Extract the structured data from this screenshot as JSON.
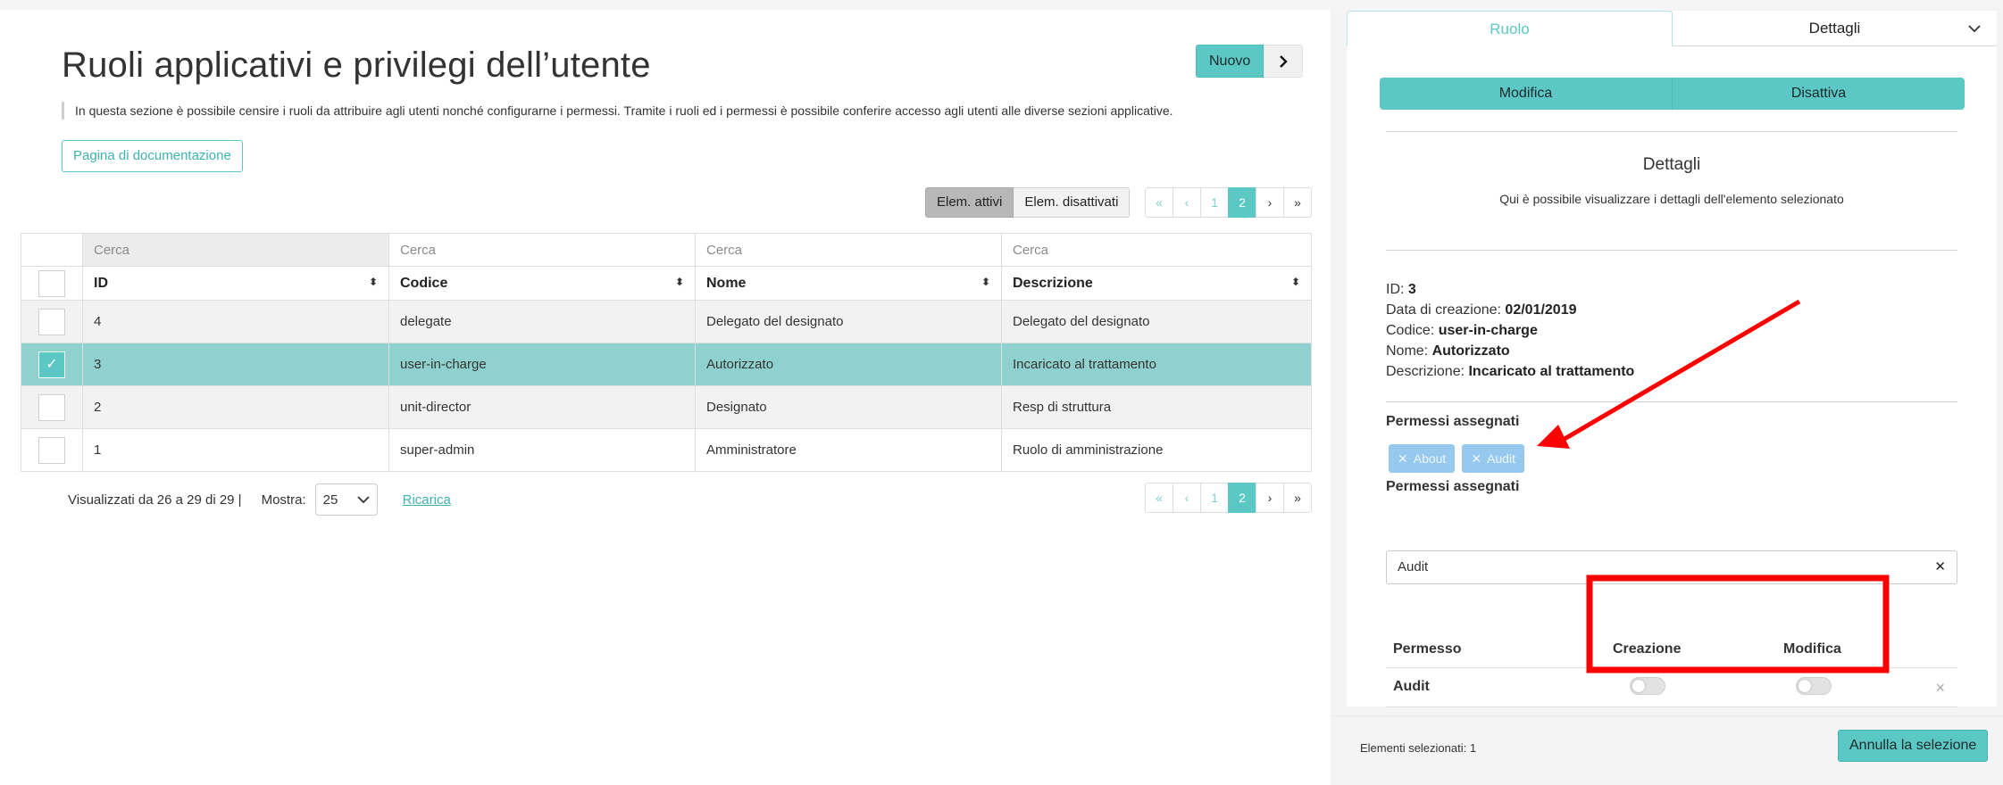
{
  "page": {
    "title": "Ruoli applicativi e privilegi dell’utente",
    "description": "In questa sezione è possibile censire i ruoli da attribuire agli utenti nonché configurarne i permessi. Tramite i ruoli ed i permessi è possibile conferire accesso agli utenti alle diverse sezioni applicative.",
    "doc_button": "Pagina di documentazione",
    "new_button": "Nuovo"
  },
  "filters": {
    "active": "Elem. attivi",
    "inactive": "Elem. disattivati"
  },
  "pager": {
    "first": "«",
    "prev": "‹",
    "page1": "1",
    "page2": "2",
    "next": "›",
    "last": "»"
  },
  "table": {
    "search_placeholder": "Cerca",
    "columns": [
      "ID",
      "Codice",
      "Nome",
      "Descrizione"
    ],
    "sort_icon": "⬍",
    "rows": [
      {
        "id": "4",
        "codice": "delegate",
        "nome": "Delegato del designato",
        "descrizione": "Delegato del designato",
        "selected": false
      },
      {
        "id": "3",
        "codice": "user-in-charge",
        "nome": "Autorizzato",
        "descrizione": "Incaricato al trattamento",
        "selected": true
      },
      {
        "id": "2",
        "codice": "unit-director",
        "nome": "Designato",
        "descrizione": "Resp di struttura",
        "selected": false
      },
      {
        "id": "1",
        "codice": "super-admin",
        "nome": "Amministratore",
        "descrizione": "Ruolo di amministrazione",
        "selected": false
      }
    ],
    "check_mark": "✓"
  },
  "footer": {
    "summary": "Visualizzati da 26 a 29 di 29 |",
    "show_label": "Mostra:",
    "page_size": "25",
    "reload": "Ricarica"
  },
  "side": {
    "tabs": {
      "ruolo": "Ruolo",
      "dettagli": "Dettagli"
    },
    "actions": {
      "modifica": "Modifica",
      "disattiva": "Disattiva"
    },
    "details_title": "Dettagli",
    "details_subtitle": "Qui è possibile visualizzare i dettagli dell'elemento selezionato",
    "fields": {
      "id_label": "ID:",
      "id_value": "3",
      "created_label": "Data di creazione:",
      "created_value": "02/01/2019",
      "code_label": "Codice:",
      "code_value": "user-in-charge",
      "name_label": "Nome:",
      "name_value": "Autorizzato",
      "desc_label": "Descrizione:",
      "desc_value": "Incaricato al trattamento"
    },
    "perm_label": "Permessi assegnati",
    "chips": [
      "About",
      "Audit"
    ],
    "chip_remove": "✕",
    "perm_label_2": "Permessi assegnati",
    "perm_select_value": "Audit",
    "perm_select_clear": "✕",
    "perm_table": {
      "col_permesso": "Permesso",
      "col_creazione": "Creazione",
      "col_modifica": "Modifica",
      "row_name": "Audit",
      "row_remove": "×"
    },
    "selected_count": "Elementi selezionati: 1",
    "cancel_selection": "Annulla la selezione"
  },
  "colors": {
    "accent": "#5bc8c6",
    "selected_row": "#8fd1cf",
    "chip": "#97c9ee",
    "annotation": "#ff0000"
  }
}
